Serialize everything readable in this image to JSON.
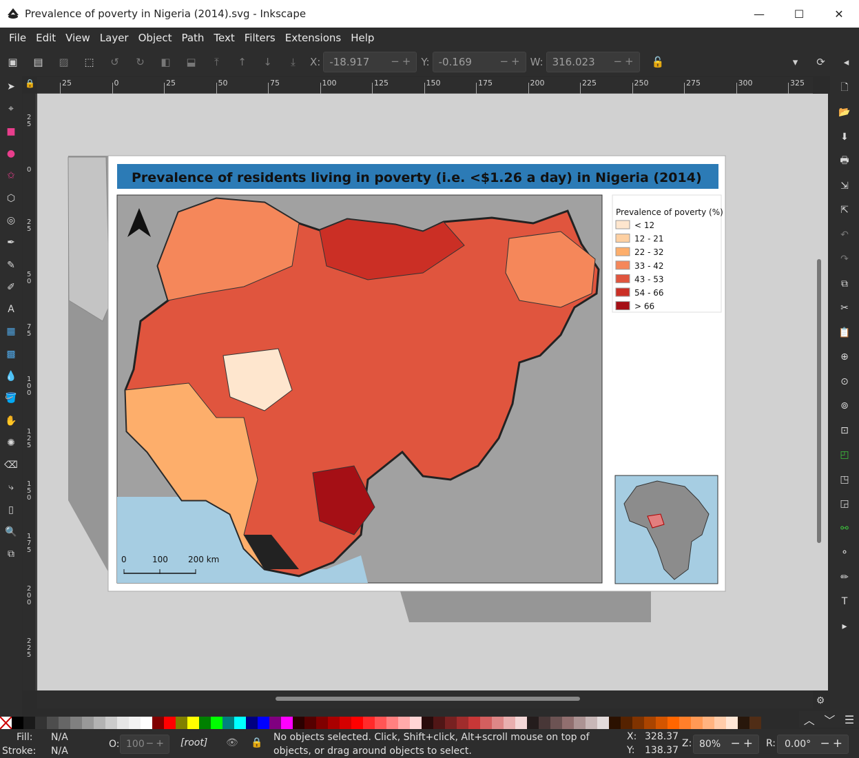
{
  "window": {
    "title": "Prevalence of poverty in Nigeria (2014).svg - Inkscape",
    "minimize": "—",
    "maximize": "☐",
    "close": "✕"
  },
  "menu": [
    "File",
    "Edit",
    "View",
    "Layer",
    "Object",
    "Path",
    "Text",
    "Filters",
    "Extensions",
    "Help"
  ],
  "toolbar": {
    "x_label": "X:",
    "x_value": "-18.917",
    "y_label": "Y:",
    "y_value": "-0.169",
    "w_label": "W:",
    "w_value": "316.023"
  },
  "ruler": {
    "h_ticks": [
      "25",
      "0",
      "25",
      "50",
      "75",
      "100",
      "125",
      "150",
      "175",
      "200",
      "225",
      "250",
      "275",
      "300",
      "325"
    ],
    "v_ticks": [
      "2\n5",
      "0",
      "2\n5",
      "5\n0",
      "7\n5",
      "1\n0\n0",
      "1\n2\n5",
      "1\n5\n0",
      "1\n7\n5",
      "2\n0\n0",
      "2\n2\n5"
    ]
  },
  "map": {
    "title": "Prevalence of residents living in poverty (i.e. <$1.26 a day) in Nigeria (2014)",
    "legend_title": "Prevalence of poverty (%)",
    "legend": [
      {
        "label": "< 12",
        "color": "#fee6ce"
      },
      {
        "label": "12 - 21",
        "color": "#fdd0a2"
      },
      {
        "label": "22 - 32",
        "color": "#fdae6b"
      },
      {
        "label": "33 - 42",
        "color": "#f5875a"
      },
      {
        "label": "43 - 53",
        "color": "#e0553e"
      },
      {
        "label": "54 - 66",
        "color": "#cb2f25"
      },
      {
        "label": "> 66",
        "color": "#a50f15"
      }
    ],
    "scale": {
      "zero": "0",
      "mid": "100",
      "end": "200 km"
    },
    "north": "N"
  },
  "palette": [
    "#000000",
    "#1a1a1a",
    "#333333",
    "#4d4d4d",
    "#666666",
    "#808080",
    "#999999",
    "#b3b3b3",
    "#cccccc",
    "#e6e6e6",
    "#f2f2f2",
    "#ffffff",
    "#800000",
    "#ff0000",
    "#808000",
    "#ffff00",
    "#008000",
    "#00ff00",
    "#008080",
    "#00ffff",
    "#000080",
    "#0000ff",
    "#800080",
    "#ff00ff",
    "#2b0000",
    "#550000",
    "#800000",
    "#aa0000",
    "#d40000",
    "#ff0000",
    "#ff2a2a",
    "#ff5555",
    "#ff8080",
    "#ffaaaa",
    "#ffd5d5",
    "#280b0b",
    "#501616",
    "#782121",
    "#a02c2c",
    "#c83737",
    "#d35f5f",
    "#de8787",
    "#e9afaf",
    "#f4d7d7",
    "#241c1c",
    "#483737",
    "#6c5353",
    "#916f6f",
    "#ac9393",
    "#c8b7b7",
    "#e3dbdb",
    "#2b1100",
    "#552200",
    "#803300",
    "#aa4400",
    "#d45500",
    "#ff6600",
    "#ff7f2a",
    "#ff9955",
    "#ffb380",
    "#ffccaa",
    "#ffe6d5",
    "#28170b",
    "#502d16"
  ],
  "status": {
    "fill_label": "Fill:",
    "fill_value": "N/A",
    "stroke_label": "Stroke:",
    "stroke_value": "N/A",
    "opacity_label": "O:",
    "opacity_value": "100",
    "layer": "[root]",
    "message": "No objects selected. Click, Shift+click, Alt+scroll mouse on top of objects, or drag around objects to select.",
    "x_label": "X:",
    "x_value": "328.37",
    "y_label": "Y:",
    "y_value": "138.37",
    "zoom_label": "Z:",
    "zoom_value": "80%",
    "rotate_label": "R:",
    "rotate_value": "0.00°"
  }
}
